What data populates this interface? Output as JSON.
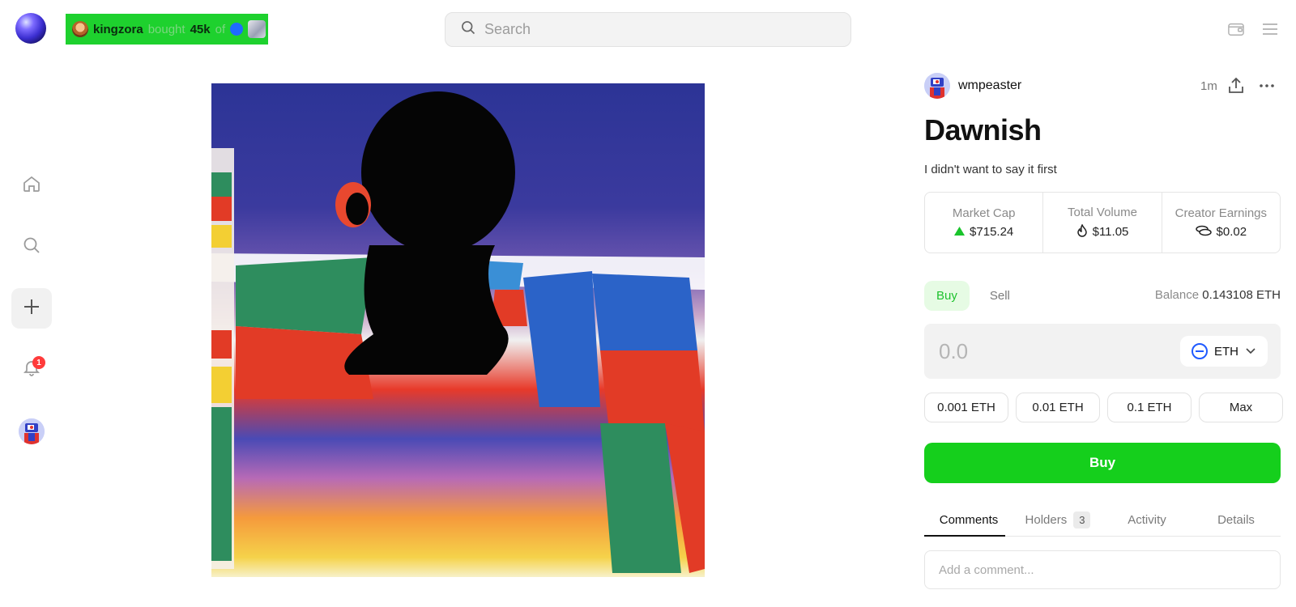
{
  "ticker": {
    "user": "kingzora",
    "verb": "bought",
    "amount": "45k",
    "prep": "of"
  },
  "search": {
    "placeholder": "Search"
  },
  "sidebar": {
    "items": [
      {
        "name": "home",
        "icon": "home-icon"
      },
      {
        "name": "search",
        "icon": "search-icon"
      },
      {
        "name": "create",
        "icon": "plus-icon"
      },
      {
        "name": "notifications",
        "icon": "bell-icon",
        "badge": "1"
      },
      {
        "name": "profile",
        "icon": "avatar"
      }
    ]
  },
  "header_icons": [
    "wallet-icon",
    "menu-icon"
  ],
  "post": {
    "creator": "wmpeaster",
    "age": "1m",
    "title": "Dawnish",
    "description": "I didn't want to say it first"
  },
  "stats": [
    {
      "label": "Market Cap",
      "value": "$715.24",
      "icon": "triangle-up-icon",
      "color": "#19c42b"
    },
    {
      "label": "Total Volume",
      "value": "$11.05",
      "icon": "flame-icon"
    },
    {
      "label": "Creator Earnings",
      "value": "$0.02",
      "icon": "coins-icon"
    }
  ],
  "trade": {
    "tabs": [
      "Buy",
      "Sell"
    ],
    "active_tab": "Buy",
    "balance_label": "Balance",
    "balance_value": "0.143108 ETH",
    "amount_placeholder": "0.0",
    "currency": "ETH",
    "presets": [
      "0.001 ETH",
      "0.01 ETH",
      "0.1 ETH",
      "Max"
    ],
    "buy_label": "Buy"
  },
  "info_tabs": [
    {
      "label": "Comments",
      "active": true
    },
    {
      "label": "Holders",
      "count": "3"
    },
    {
      "label": "Activity"
    },
    {
      "label": "Details"
    }
  ],
  "comment": {
    "placeholder": "Add a comment..."
  },
  "colors": {
    "accent_green": "#15cf1c",
    "ticker_bg": "#1ed12e",
    "notification_red": "#ff3b3b"
  }
}
